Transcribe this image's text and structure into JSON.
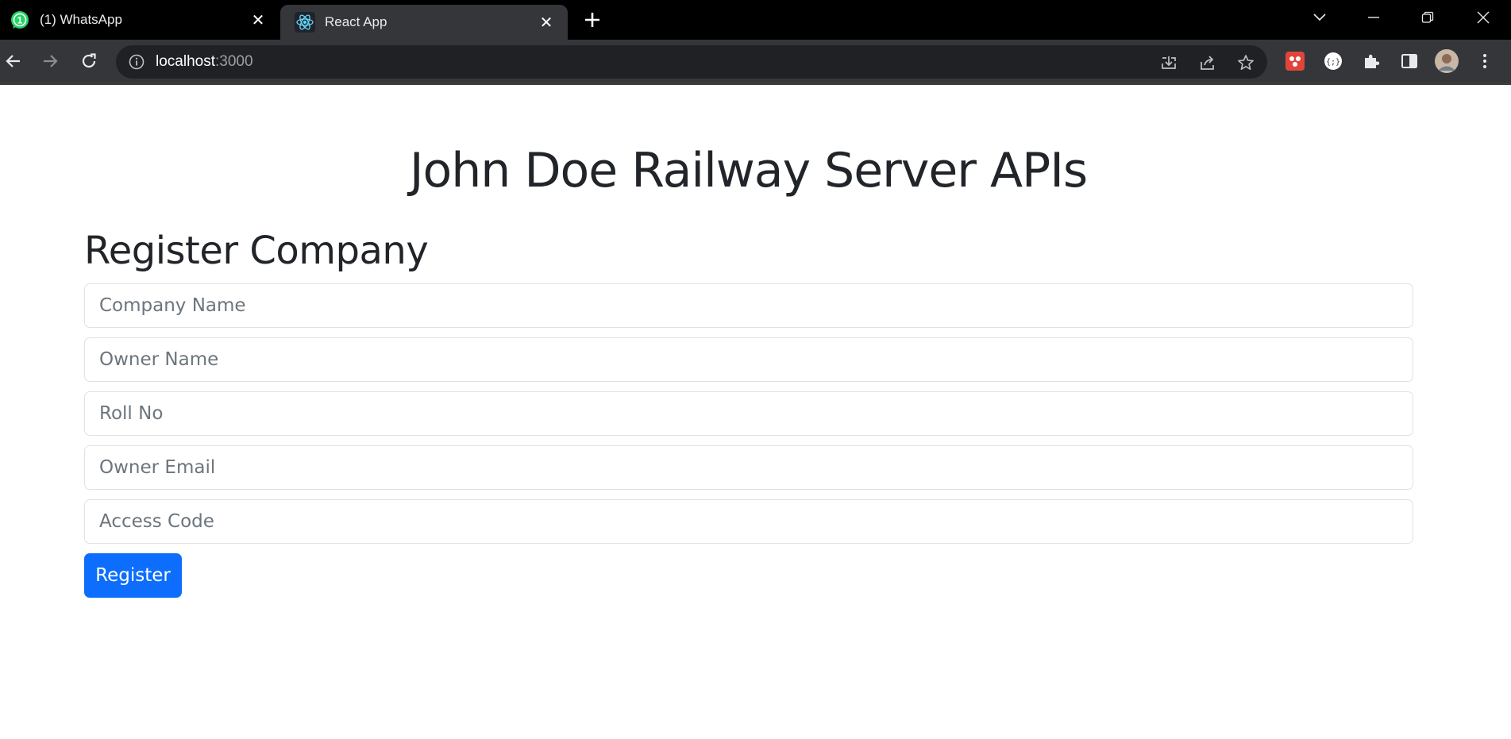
{
  "browser": {
    "tabs": [
      {
        "title": "(1) WhatsApp",
        "icon": "whatsapp-icon",
        "badge": "1",
        "active": false
      },
      {
        "title": "React App",
        "icon": "react-icon",
        "active": true
      }
    ],
    "address": {
      "host": "localhost",
      "port": ":3000"
    }
  },
  "page": {
    "title": "John Doe Railway Server APIs",
    "section_title": "Register Company",
    "form": {
      "fields": [
        {
          "placeholder": "Company Name",
          "value": ""
        },
        {
          "placeholder": "Owner Name",
          "value": ""
        },
        {
          "placeholder": "Roll No",
          "value": ""
        },
        {
          "placeholder": "Owner Email",
          "value": ""
        },
        {
          "placeholder": "Access Code",
          "value": ""
        }
      ],
      "submit_label": "Register"
    }
  },
  "colors": {
    "primary_button": "#0d6efd",
    "text": "#212529",
    "chrome_dark": "#35363a"
  }
}
